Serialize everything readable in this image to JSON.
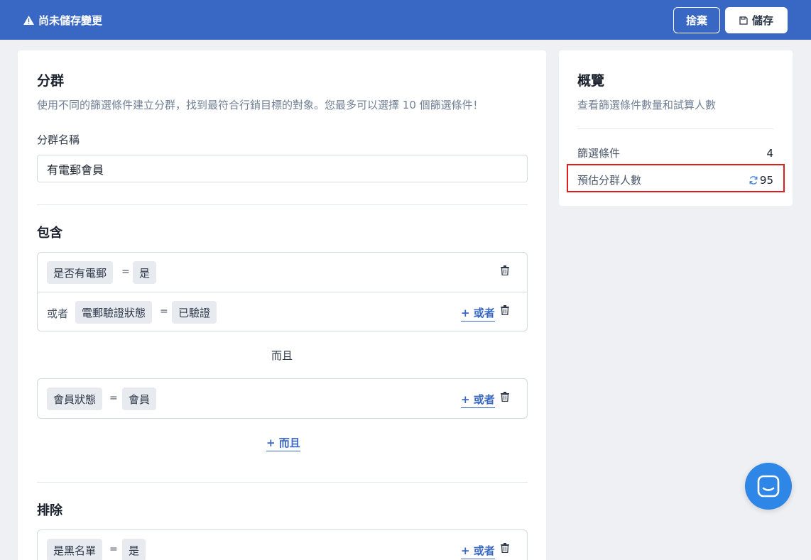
{
  "topbar": {
    "warning_text": "尚未儲存變更",
    "discard_label": "捨棄",
    "save_label": "儲存",
    "bg_color": "#3867c4"
  },
  "main": {
    "title": "分群",
    "description": "使用不同的篩選條件建立分群，找到最符合行銷目標的對象。您最多可以選擇 10 個篩選條件！",
    "name_label": "分群名稱",
    "name_value": "有電郵會員",
    "include_title": "包含",
    "exclude_title": "排除",
    "equals": "=",
    "or_prefix": "或者",
    "add_or_label": "+ 或者",
    "and_label": "而且",
    "add_and_label": "+ 而且",
    "include_groups": [
      {
        "rows": [
          {
            "field": "是否有電郵",
            "value": "是"
          },
          {
            "field": "電郵驗證狀態",
            "value": "已驗證"
          }
        ]
      },
      {
        "rows": [
          {
            "field": "會員狀態",
            "value": "會員"
          }
        ]
      }
    ],
    "exclude_groups": [
      {
        "rows": [
          {
            "field": "是黑名單",
            "value": "是"
          }
        ]
      }
    ]
  },
  "overview": {
    "title": "概覽",
    "description": "查看篩選條件數量和試算人數",
    "filters_label": "篩選條件",
    "filters_count": "4",
    "estimate_label": "預估分群人數",
    "estimate_value": "95",
    "highlight_color": "#e01e1e"
  },
  "icons": {
    "warning": "warning-icon",
    "save": "floppy-disk-icon",
    "trash": "trash-icon",
    "refresh": "refresh-icon",
    "chat": "chat-icon"
  }
}
